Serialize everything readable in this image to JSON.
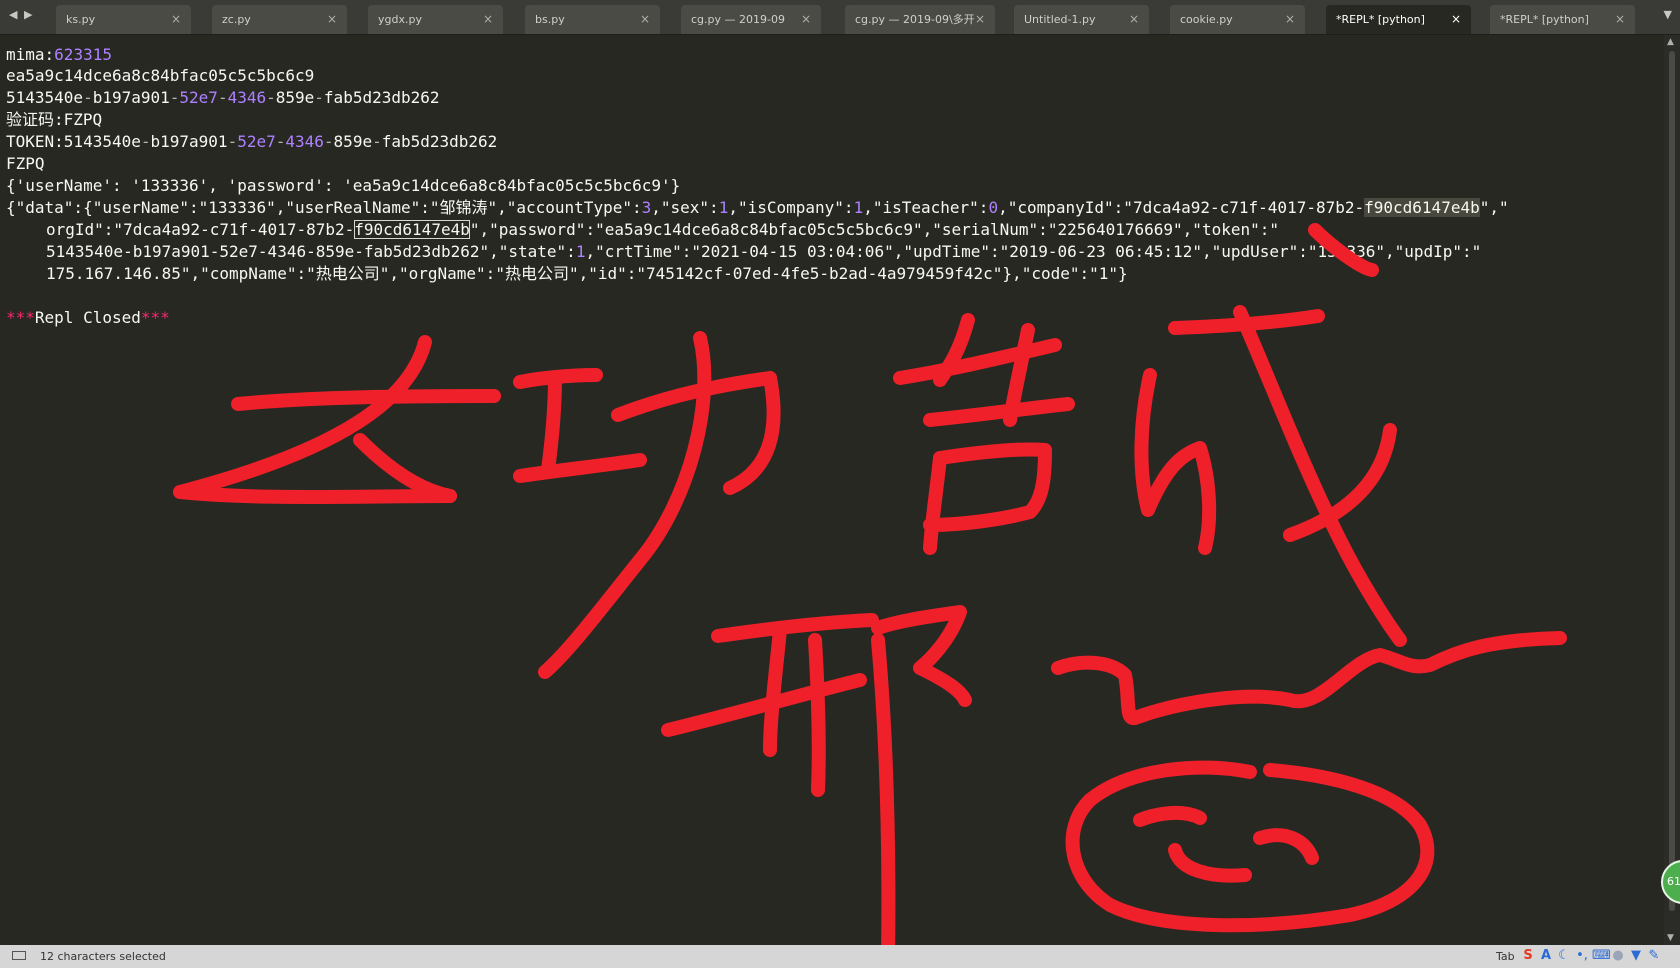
{
  "tabs": [
    {
      "label": "ks.py",
      "active": false
    },
    {
      "label": "zc.py",
      "active": false
    },
    {
      "label": "ygdx.py",
      "active": false
    },
    {
      "label": "bs.py",
      "active": false
    },
    {
      "label": "cg.py — 2019-09",
      "active": false
    },
    {
      "label": "cg.py — 2019-09\\多开",
      "active": false
    },
    {
      "label": "Untitled-1.py",
      "active": false
    },
    {
      "label": "cookie.py",
      "active": false
    },
    {
      "label": "*REPL* [python]",
      "active": true
    },
    {
      "label": "*REPL* [python]",
      "active": false
    }
  ],
  "tab_close_glyph": "×",
  "nav": {
    "left": "◀",
    "right": "▶",
    "menu": "▼"
  },
  "editor": {
    "l1": {
      "key": "mima:",
      "value": "623315"
    },
    "l2": "ea5a9c14dce6a8c84bfac05c5c5bc6c9",
    "l3": {
      "a": "5143540e",
      "b": "b197a901",
      "c": "52e7",
      "d": "4346",
      "e": "859e",
      "f": "fab5d23db262",
      "sep": "-"
    },
    "l4": "验证码:FZPQ",
    "l5": {
      "prefix": "TOKEN:"
    },
    "l6": "FZPQ",
    "l7": "{'userName': '133336', 'password': 'ea5a9c14dce6a8c84bfac05c5c5bc6c9'}",
    "l8": {
      "p1": "{\"data\":{\"userName\":\"133336\",\"userRealName\":\"邹锦涛\",\"accountType\":",
      "n1": "3",
      "p2": ",\"sex\":",
      "n2": "1",
      "p3": ",\"isCompany\":",
      "n3": "1",
      "p4": ",\"isTeacher\":",
      "n4": "0",
      "p5": ",\"companyId\":\"7dca4a92-c71f-4017-87b2-",
      "hl": "f90cd6147e4b",
      "p6": "\",\""
    },
    "l9": {
      "p1": "orgId\":\"7dca4a92-c71f-4017-87b2-",
      "box": "f90cd6147e4b",
      "p2": "\",\"password\":\"ea5a9c14dce6a8c84bfac05c5c5bc6c9\",\"serialNum\":\"225640176669\",\"token\":\""
    },
    "l10": {
      "p1": "5143540e-b197a901-52e7-4346-859e-fab5d23db262\",\"state\":",
      "n1": "1",
      "p2": ",\"crtTime\":\"2021-04-15 03:04:06\",\"updTime\":\"2019-06-23 06:45:12\",\"updUser\":\"133336\",\"updIp\":\""
    },
    "l11": "175.167.146.85\",\"compName\":\"热电公司\",\"orgName\":\"热电公司\",\"id\":\"745142cf-07ed-4fe5-b2ad-4a979459f42c\"},\"code\":\"1\"}",
    "l13": {
      "stars": "***",
      "text": "Repl Closed"
    }
  },
  "scrollbar": {
    "up": "▲",
    "down": "▼"
  },
  "badge": "61",
  "status": {
    "selection": "12 characters selected",
    "tab_label": "Tab",
    "tray_icons": [
      "sogou-s-icon",
      "font-a-icon",
      "moon-icon",
      "punctuation-icon",
      "keyboard-icon",
      "user-icon",
      "shirt-icon",
      "wrench-icon"
    ]
  },
  "colors": {
    "background": "#272822",
    "number": "#ae81ff",
    "keyword": "#f92672",
    "scribble": "#f0202a"
  }
}
